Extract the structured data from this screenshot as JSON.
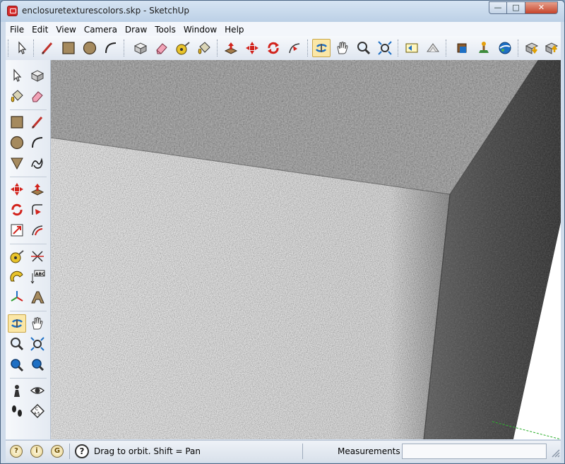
{
  "window": {
    "title": "enclosuretexturescolors.skp - SketchUp"
  },
  "menu": {
    "items": [
      "File",
      "Edit",
      "View",
      "Camera",
      "Draw",
      "Tools",
      "Window",
      "Help"
    ]
  },
  "status": {
    "hint": "Drag to orbit.  Shift = Pan",
    "measurements_label": "Measurements",
    "measurements_value": ""
  },
  "icons": {
    "top_toolbar": [
      "select-icon",
      "line-icon",
      "rectangle-icon",
      "circle-icon",
      "arc-icon",
      "make-component-icon",
      "eraser-icon",
      "tape-measure-icon",
      "paint-bucket-icon",
      "push-pull-icon",
      "move-icon",
      "rotate-icon",
      "follow-me-icon",
      "orbit-icon",
      "pan-icon",
      "zoom-icon",
      "zoom-extents-icon",
      "previous-view-icon",
      "next-view-icon",
      "warehouse-icon",
      "extension-icon",
      "google-earth-icon",
      "get-models-icon",
      "share-model-icon"
    ],
    "left_toolbar": [
      "select-icon",
      "make-component-icon",
      "paint-bucket-icon",
      "eraser-icon",
      "rectangle-icon",
      "line-icon",
      "circle-icon",
      "arc-icon",
      "polygon-icon",
      "freehand-icon",
      "move-icon",
      "push-pull-icon",
      "rotate-icon",
      "follow-me-icon",
      "scale-icon",
      "offset-icon",
      "tape-measure-icon",
      "dimension-icon",
      "protractor-icon",
      "text-icon",
      "axes-icon",
      "3d-text-icon",
      "orbit-icon",
      "pan-icon",
      "zoom-icon",
      "zoom-window-icon",
      "zoom-extents-icon",
      "previous-view-icon",
      "position-camera-icon",
      "look-around-icon",
      "walk-icon",
      "section-plane-icon"
    ]
  },
  "colors": {
    "accent": "#1d6fc4",
    "active_tool": "#fbe7a6"
  }
}
